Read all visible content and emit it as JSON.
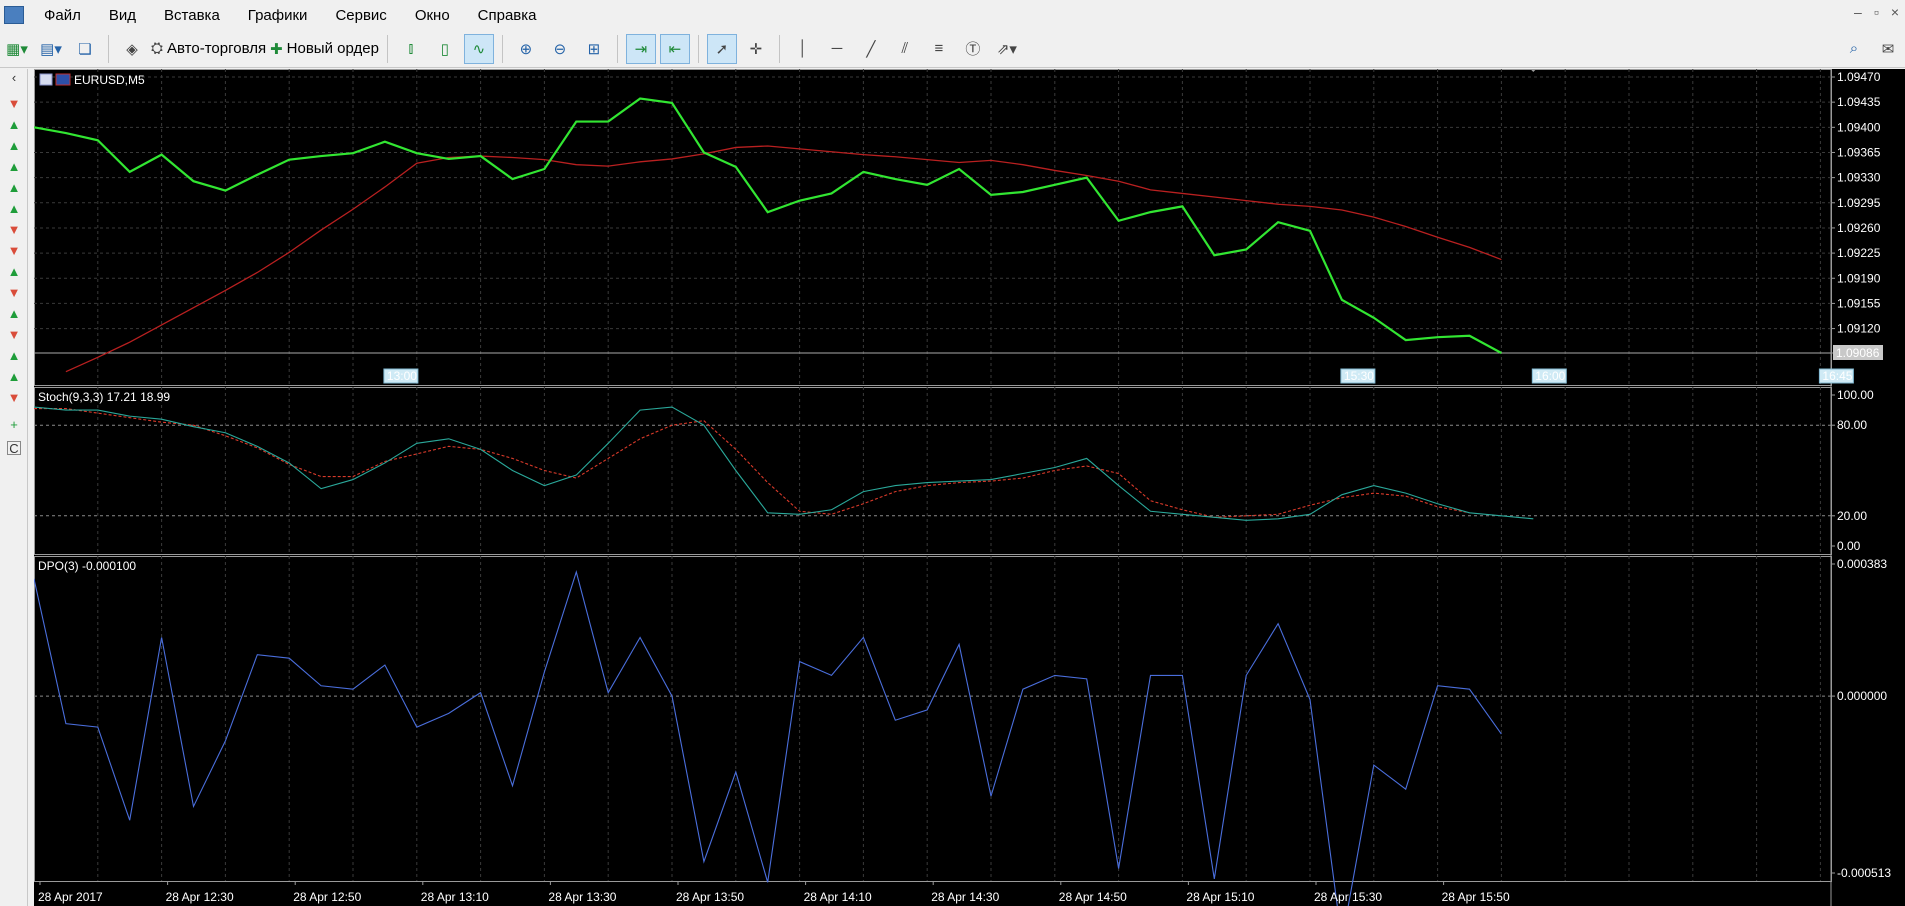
{
  "menu": [
    "Файл",
    "Вид",
    "Вставка",
    "Графики",
    "Сервис",
    "Окно",
    "Справка"
  ],
  "window_controls": [
    "–",
    "▫",
    "×"
  ],
  "toolbar": {
    "auto_trading_label": "Авто-торговля",
    "new_order_label": "Новый ордер"
  },
  "sidebar": {
    "arrows": [
      "down",
      "up",
      "up",
      "up",
      "up",
      "up",
      "down",
      "down",
      "up",
      "down",
      "up",
      "down",
      "up",
      "up",
      "down"
    ],
    "plus": "+",
    "c_label": "C"
  },
  "colors": {
    "price": "#32e632",
    "ma": "#b92020",
    "stoch_main": "#2aa89a",
    "stoch_signal": "#d93a2a",
    "dpo": "#4a6edc",
    "grid": "#3a3a3a",
    "background": "#000000"
  },
  "chart_data": [
    {
      "type": "line",
      "title": "EURUSD,M5",
      "y_ticks": [
        "1.09470",
        "1.09435",
        "1.09400",
        "1.09365",
        "1.09330",
        "1.09295",
        "1.09260",
        "1.09225",
        "1.09190",
        "1.09155",
        "1.09120",
        "1.09086"
      ],
      "ylim": [
        1.0907,
        1.0948
      ],
      "current_price": "1.09086",
      "x_count": 47,
      "time_markers": [
        {
          "label": "13:00",
          "x": 11
        },
        {
          "label": "15:30",
          "x": 41
        },
        {
          "label": "16:00",
          "x": 47
        },
        {
          "label": "16:45",
          "x": 56
        }
      ],
      "series": [
        {
          "values": [
            1.094,
            1.09392,
            1.09382,
            1.09338,
            1.09362,
            1.09325,
            1.09312,
            1.09334,
            1.09355,
            1.0936,
            1.09364,
            1.0938,
            1.09364,
            1.09356,
            1.0936,
            1.09328,
            1.09342,
            1.09408,
            1.09408,
            1.0944,
            1.09434,
            1.09365,
            1.09345,
            1.09282,
            1.09298,
            1.09308,
            1.09338,
            1.09328,
            1.0932,
            1.09342,
            1.09306,
            1.0931,
            1.0932,
            1.0933,
            1.0927,
            1.09282,
            1.0929,
            1.09222,
            1.0923,
            1.09268,
            1.09256,
            1.0916,
            1.09135,
            1.09104,
            1.09108,
            1.0911,
            1.09086
          ]
        },
        {
          "start_index": 1,
          "values": [
            1.0906,
            1.0908,
            1.09101,
            1.09125,
            1.09149,
            1.09173,
            1.09198,
            1.09226,
            1.09257,
            1.09286,
            1.09317,
            1.0935,
            1.09358,
            1.0936,
            1.09358,
            1.09355,
            1.09348,
            1.09346,
            1.09352,
            1.09356,
            1.09363,
            1.09372,
            1.09374,
            1.0937,
            1.09366,
            1.09362,
            1.09359,
            1.09355,
            1.09351,
            1.09354,
            1.09348,
            1.0934,
            1.09333,
            1.09325,
            1.09313,
            1.09308,
            1.09303,
            1.09298,
            1.09293,
            1.0929,
            1.09285,
            1.09275,
            1.09262,
            1.09247,
            1.09233,
            1.09216
          ]
        }
      ]
    },
    {
      "type": "line",
      "title": "Stoch(9,3,3) 17.21 18.99",
      "y_ticks": [
        "100.00",
        "80.00",
        "20.00",
        "0.00"
      ],
      "ylim": [
        0,
        100
      ],
      "levels": [
        80,
        20
      ],
      "series": [
        {
          "values": [
            92,
            90,
            90,
            86,
            84,
            79,
            75,
            66,
            55,
            38,
            44,
            55,
            68,
            71,
            64,
            50,
            40,
            47,
            68,
            90,
            92,
            80,
            50,
            22,
            21,
            24,
            36,
            40,
            42,
            43,
            44,
            48,
            52,
            58,
            40,
            23,
            21,
            19,
            17,
            18,
            21,
            34,
            40,
            35,
            28,
            22,
            20,
            18
          ]
        },
        {
          "values": [
            91,
            91,
            88,
            85,
            82,
            80,
            73,
            65,
            54,
            46,
            46,
            56,
            61,
            66,
            64,
            58,
            50,
            45,
            58,
            71,
            80,
            83,
            64,
            42,
            23,
            21,
            28,
            36,
            40,
            42,
            43,
            45,
            50,
            53,
            48,
            30,
            24,
            19,
            20,
            21,
            27,
            32,
            35,
            33,
            26,
            22
          ]
        }
      ]
    },
    {
      "type": "line",
      "title": "DPO(3) -0.000100",
      "y_ticks": [
        "0.000383",
        "0.000000",
        "-0.000513"
      ],
      "ylim": [
        -0.000513,
        0.000383
      ],
      "series": [
        {
          "values": [
            0.00034,
            -8e-05,
            -9e-05,
            -0.00036,
            0.00017,
            -0.00032,
            -0.00013,
            0.00012,
            0.00011,
            3e-05,
            2e-05,
            9e-05,
            -9e-05,
            -5e-05,
            1e-05,
            -0.00026,
            7e-05,
            0.00036,
            1e-05,
            0.00017,
            0.0,
            -0.00048,
            -0.00022,
            -0.00054,
            0.0001,
            6e-05,
            0.00017,
            -7e-05,
            -4e-05,
            0.00015,
            -0.00029,
            2e-05,
            6e-05,
            5e-05,
            -0.0005,
            6e-05,
            6e-05,
            -0.00053,
            6e-05,
            0.00021,
            -1e-05,
            -0.00071,
            -0.0002,
            -0.00027,
            3e-05,
            2e-05,
            -0.00011
          ]
        }
      ]
    }
  ],
  "time_axis": [
    "28 Apr 2017",
    "28 Apr 12:30",
    "28 Apr 12:50",
    "28 Apr 13:10",
    "28 Apr 13:30",
    "28 Apr 13:50",
    "28 Apr 14:10",
    "28 Apr 14:30",
    "28 Apr 14:50",
    "28 Apr 15:10",
    "28 Apr 15:30",
    "28 Apr 15:50"
  ]
}
